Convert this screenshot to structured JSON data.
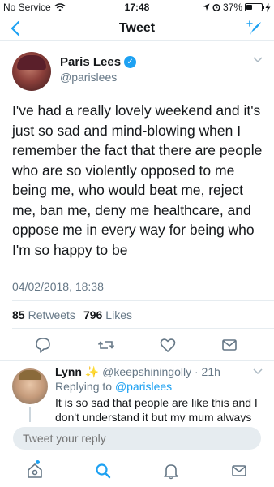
{
  "status": {
    "carrier": "No Service",
    "time": "17:48",
    "battery": "37%",
    "battery_level": 0.37
  },
  "nav": {
    "title": "Tweet"
  },
  "tweet": {
    "name": "Paris Lees",
    "handle": "@parislees",
    "text": "I've had a really lovely weekend and it's just so sad and mind-blowing when I remember the fact that there are people who are so violently opposed to me being me, who would beat me, reject me, ban me, deny me healthcare, and oppose me in every way for being who I'm so happy to be",
    "date": "04/02/2018, 18:38",
    "retweets_count": "85",
    "retweets_label": "Retweets",
    "likes_count": "796",
    "likes_label": "Likes"
  },
  "reply": {
    "name": "Lynn",
    "sparkle": "✨",
    "handle": "@keepshiningolly",
    "separator": "·",
    "time": "21h",
    "replying_label": "Replying to",
    "replying_to": "@parislees",
    "text": "It is so sad that people are like this and I don't understand it but my mum always"
  },
  "compose": {
    "placeholder": "Tweet your reply"
  },
  "colors": {
    "accent": "#1da1f2",
    "muted": "#657786",
    "text": "#14171a",
    "divider": "#e6ecf0"
  },
  "icons": [
    "wifi-icon",
    "location-icon",
    "alarm-icon",
    "charging-icon",
    "back-chevron-icon",
    "compose-icon",
    "verified-icon",
    "caret-down-icon",
    "reply-icon",
    "retweet-icon",
    "like-icon",
    "message-icon",
    "home-icon",
    "search-icon",
    "notifications-icon",
    "messages-icon"
  ]
}
